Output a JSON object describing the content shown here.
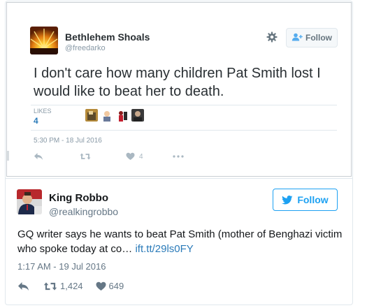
{
  "quoted_tweet": {
    "author_name": "Bethlehem Shoals",
    "author_handle": "@freedarko",
    "follow_label": "Follow",
    "text": "I don't care how many children Pat Smith lost I would like to beat her to death.",
    "likes_label": "LIKES",
    "likes_count": "4",
    "timestamp": "5:30 PM - 18 Jul 2016",
    "likes_action_count": "4",
    "icons": [
      "settings-gear-icon",
      "follow-person-plus-icon",
      "reply-icon",
      "retweet-icon",
      "heart-icon",
      "more-dots-icon"
    ]
  },
  "tweet": {
    "author_name": "King Robbo",
    "author_handle": "@realkingrobbo",
    "follow_label": "Follow",
    "text": "GQ writer says he wants to beat Pat Smith (mother of Benghazi victim who spoke today at co…",
    "link_text": "ift.tt/29ls0FY",
    "timestamp": "1:17 AM - 19 Jul 2016",
    "retweet_count": "1,424",
    "like_count": "649",
    "icons": [
      "twitter-bird-icon",
      "reply-icon",
      "retweet-icon",
      "heart-icon"
    ]
  },
  "colors": {
    "brand_blue": "#1da1f2",
    "link_blue": "#2b7bb9",
    "muted_gray": "#657786"
  }
}
